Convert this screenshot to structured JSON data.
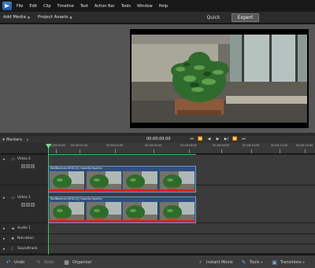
{
  "menu": {
    "items": [
      "File",
      "Edit",
      "Clip",
      "Timeline",
      "Text",
      "Action Bar",
      "Tools",
      "Window",
      "Help"
    ]
  },
  "toolbar": {
    "add_media": "Add Media",
    "project_assets": "Project Assets",
    "quick": "Quick",
    "expert": "Expert"
  },
  "timeline": {
    "markers_label": "Markers",
    "timecode": "00;00;00;00",
    "ruler_labels": [
      "00;00;00;00",
      "00;00;01;00",
      "00;00;02;00",
      "00;00;04;00",
      "00;00;06;00",
      "00;00;08;00",
      "00;00;10;00",
      "00;00;12;00",
      "00;00;14;00"
    ],
    "tracks": [
      {
        "name": "Video 2",
        "icon": "film-icon"
      },
      {
        "name": "Video 1",
        "icon": "film-icon"
      },
      {
        "name": "Audio 1",
        "icon": "speaker-icon"
      },
      {
        "name": "Narration",
        "icon": "microphone-icon"
      },
      {
        "name": "Soundtrack",
        "icon": "music-icon"
      }
    ],
    "clips": {
      "video2_title": "RedBoxman.MOD [V] Opacity:Opacity",
      "video1_title": "RedBoxman.MOD [V] Opacity:Opacity"
    }
  },
  "bottombar": {
    "undo": "Undo",
    "redo": "Redo",
    "organizer": "Organizer",
    "instant_movie": "Instant Movie",
    "tools": "Tools",
    "transitions": "Transitions"
  },
  "colors": {
    "accent_blue": "#6c96d4",
    "clip_red": "#d42222",
    "playhead_green": "#3fbf6a"
  }
}
